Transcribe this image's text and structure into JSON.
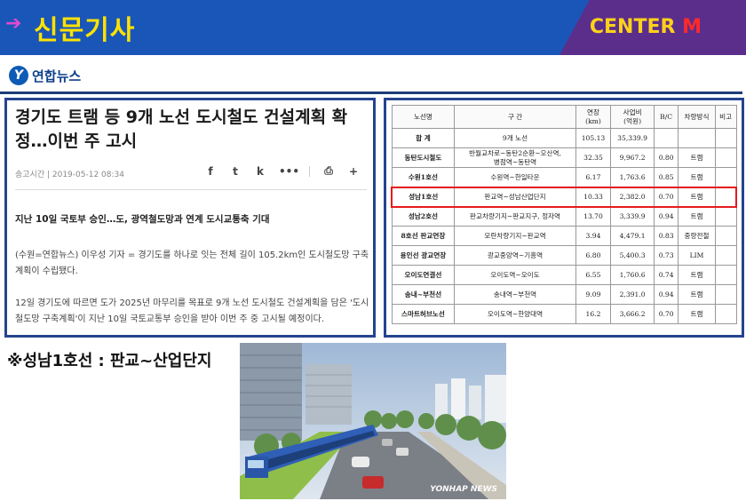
{
  "header": {
    "title": "신문기사",
    "brand": "CENTER",
    "brand_suffix": "M",
    "colors": {
      "band": "#1a56b8",
      "title": "#ffe200",
      "brand_box": "#5b2e8c",
      "brand_text": "#ffd21a",
      "brand_suffix": "#ff2a2a"
    }
  },
  "logo": {
    "name": "연합뉴스",
    "icon": "yonhap-logo-icon"
  },
  "article": {
    "title": "경기도 트램 등 9개 노선 도시철도 건설계획 확정…이번 주 고시",
    "meta": "송고시간 | 2019-05-12 08:34",
    "share_icons": [
      "facebook-icon",
      "twitter-icon",
      "kakao-icon",
      "more-icon",
      "print-icon",
      "font-plus-icon",
      "font-minus-icon"
    ],
    "share_glyphs": [
      "f",
      "t",
      "k",
      "•••",
      "⎙",
      "+",
      "−"
    ],
    "subtitle": "지난 10일 국토부 승인…도, 광역철도망과 연계 도시교통축 기대",
    "paragraph1": "(수원=연합뉴스) 이우성 기자 = 경기도를 하나로 잇는 전체 길이 105.2km인 도시철도망 구축계획이 수립됐다.",
    "paragraph2": "12일 경기도에 따르면 도가 2025년 마무리를 목표로 9개 노선 도시철도 건설계획을 담은 '도시철도망 구축계획'이 지난 10일 국토교통부 승인을 받아 이번 주 중 고시될 예정이다."
  },
  "table": {
    "headers": [
      "노선명",
      "구 간",
      "연장\n(km)",
      "사업비\n(억원)",
      "B/C",
      "차량방식",
      "비고"
    ],
    "highlight_row": 3,
    "rows": [
      [
        "합 계",
        "9개 노선",
        "105.13",
        "35,339.9",
        "",
        "",
        ""
      ],
      [
        "동탄도시철도",
        "반월교차로~동탄2순환~오산역,\n병점역~동탄역",
        "32.35",
        "9,967.2",
        "0.80",
        "트램",
        ""
      ],
      [
        "수원1호선",
        "수원역~한일타운",
        "6.17",
        "1,763.6",
        "0.85",
        "트램",
        ""
      ],
      [
        "성남1호선",
        "판교역~성남산업단지",
        "10.33",
        "2,382.0",
        "0.70",
        "트램",
        ""
      ],
      [
        "성남2호선",
        "판교차량기지~판교지구, 정자역",
        "13.70",
        "3,339.9",
        "0.94",
        "트램",
        ""
      ],
      [
        "8호선 판교연장",
        "모란차량기지~판교역",
        "3.94",
        "4,479.1",
        "0.83",
        "중량전철",
        ""
      ],
      [
        "용인선 광교연장",
        "광교중앙역~기흥역",
        "6.80",
        "5,400.3",
        "0.73",
        "LIM",
        ""
      ],
      [
        "오이도연결선",
        "오이도역~오이도",
        "6.55",
        "1,760.6",
        "0.74",
        "트램",
        ""
      ],
      [
        "송내~부천선",
        "송내역~부천역",
        "9.09",
        "2,391.0",
        "0.94",
        "트램",
        ""
      ],
      [
        "스마트허브노선",
        "오이도역~한양대역",
        "16.2",
        "3,666.2",
        "0.70",
        "트램",
        ""
      ]
    ]
  },
  "caption": "※성남1호선 : 판교~산업단지",
  "image": {
    "watermark": "YONHAP NEWS",
    "subject": "tram-rendering"
  }
}
